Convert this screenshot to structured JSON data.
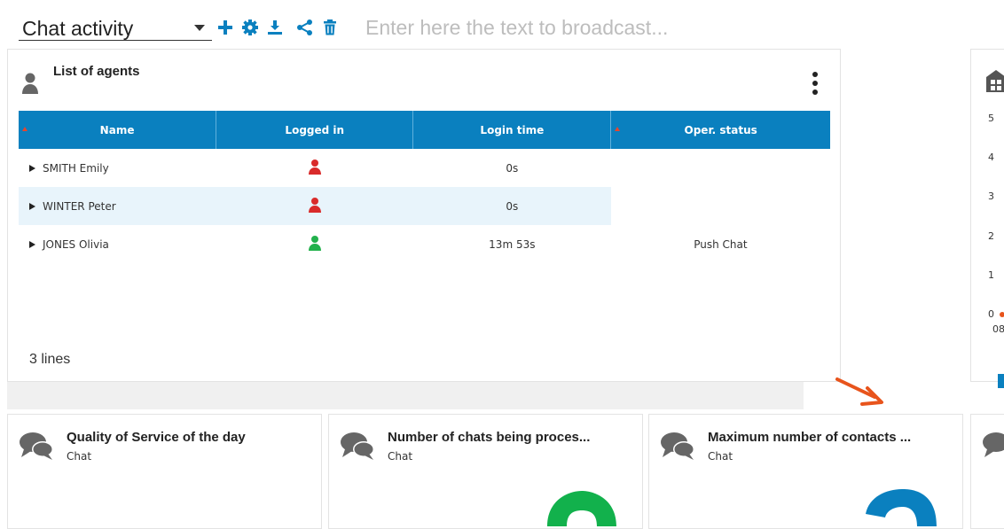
{
  "toolbar": {
    "dashboard_name": "Chat activity",
    "broadcast_placeholder": "Enter here the text to broadcast...",
    "icons": [
      "plus-icon",
      "gear-icon",
      "download-icon",
      "share-icon",
      "trash-icon"
    ],
    "accent_color": "#0a80bf"
  },
  "agents_panel": {
    "title": "List of agents",
    "columns": [
      "Name",
      "Logged in",
      "Login time",
      "Oper. status"
    ],
    "rows": [
      {
        "name": "SMITH Emily",
        "logged_in": "red",
        "login_time": "0s",
        "status": ""
      },
      {
        "name": "WINTER Peter",
        "logged_in": "red",
        "login_time": "0s",
        "status": ""
      },
      {
        "name": "JONES Olivia",
        "logged_in": "green",
        "login_time": "13m 53s",
        "status": "Push Chat"
      }
    ],
    "footer": "3 lines"
  },
  "partial_chart": {
    "y_ticks": [
      "5",
      "4",
      "3",
      "2",
      "1",
      "0"
    ],
    "x_tick": "08"
  },
  "widgets": [
    {
      "title": "Quality of Service of the day",
      "subtitle": "Chat"
    },
    {
      "title": "Number of chats being proces...",
      "subtitle": "Chat"
    },
    {
      "title": "Maximum number of contacts ...",
      "subtitle": "Chat"
    }
  ],
  "colors": {
    "status_red": "#d92b2b",
    "status_green": "#22b14c",
    "arrow": "#e8541c",
    "gauge_green": "#12b14c",
    "gauge_blue": "#0a80bf"
  }
}
